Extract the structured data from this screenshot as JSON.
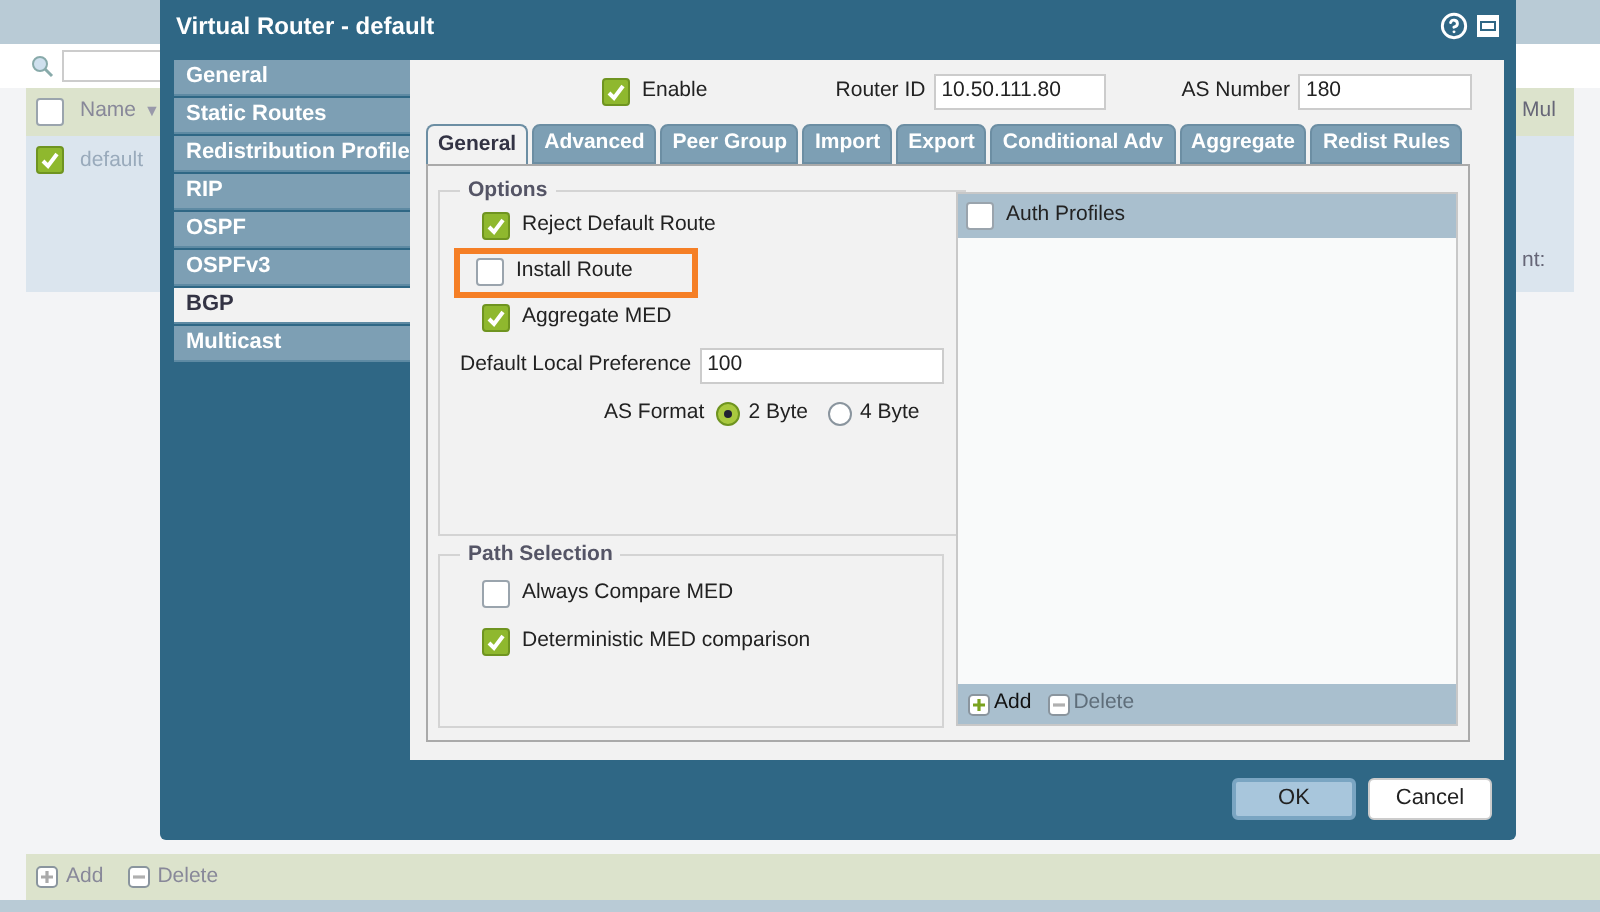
{
  "background": {
    "table": {
      "header_checked": false,
      "sort_indicator": "▼",
      "columns": [
        "Name",
        "Mul"
      ],
      "rows": [
        {
          "selected": true,
          "name": "default",
          "column_2": "nt:"
        }
      ]
    },
    "toolbar": [
      "Add",
      "Delete"
    ]
  },
  "dialog": {
    "title": "Virtual Router - default",
    "nav": [
      {
        "label": "General",
        "selected": false
      },
      {
        "label": "Static Routes",
        "selected": false
      },
      {
        "label": "Redistribution Profile",
        "selected": false
      },
      {
        "label": "RIP",
        "selected": false
      },
      {
        "label": "OSPF",
        "selected": false
      },
      {
        "label": "OSPFv3",
        "selected": false
      },
      {
        "label": "BGP",
        "selected": true
      },
      {
        "label": "Multicast",
        "selected": false
      }
    ],
    "enable": {
      "label": "Enable",
      "checked": true
    },
    "router_id": {
      "label": "Router ID",
      "value": "10.50.111.80"
    },
    "as_number": {
      "label": "AS Number",
      "value": "180"
    },
    "tabs": [
      {
        "label": "General",
        "selected": true
      },
      {
        "label": "Advanced",
        "selected": false
      },
      {
        "label": "Peer Group",
        "selected": false
      },
      {
        "label": "Import",
        "selected": false
      },
      {
        "label": "Export",
        "selected": false
      },
      {
        "label": "Conditional Adv",
        "selected": false
      },
      {
        "label": "Aggregate",
        "selected": false
      },
      {
        "label": "Redist Rules",
        "selected": false
      }
    ],
    "options": {
      "title": "Options",
      "checkboxes": [
        {
          "label": "Reject Default Route",
          "checked": true,
          "highlighted": false
        },
        {
          "label": "Install Route",
          "checked": false,
          "highlighted": true
        },
        {
          "label": "Aggregate MED",
          "checked": true,
          "highlighted": false
        }
      ],
      "local_pref": {
        "label": "Default Local Preference",
        "value": "100"
      },
      "as_format": {
        "label": "AS Format",
        "choices": [
          {
            "label": "2 Byte",
            "selected": true
          },
          {
            "label": "4 Byte",
            "selected": false
          }
        ]
      }
    },
    "path_selection": {
      "title": "Path Selection",
      "checkboxes": [
        {
          "label": "Always Compare MED",
          "checked": false
        },
        {
          "label": "Deterministic MED comparison",
          "checked": true
        }
      ]
    },
    "auth_profiles": {
      "column": "Auth Profiles",
      "checked": false,
      "toolbar": [
        {
          "label": "Add",
          "disabled": false
        },
        {
          "label": "Delete",
          "disabled": true
        }
      ]
    },
    "buttons": [
      {
        "label": "OK",
        "kind": "primary"
      },
      {
        "label": "Cancel",
        "kind": "secondary"
      }
    ]
  }
}
